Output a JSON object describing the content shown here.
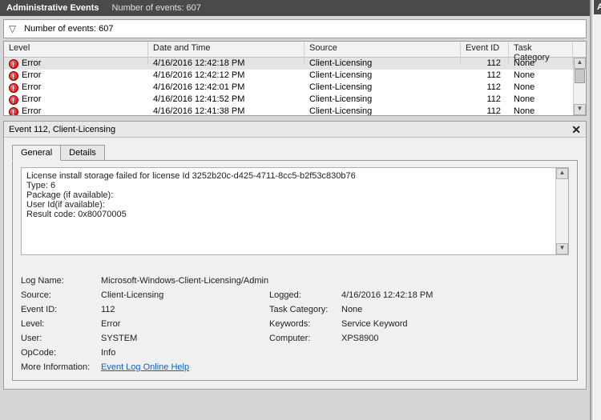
{
  "header": {
    "title": "Administrative Events",
    "subtitle": "Number of events: 607"
  },
  "filter": {
    "text": "Number of events: 607"
  },
  "columns": {
    "level": "Level",
    "datetime": "Date and Time",
    "source": "Source",
    "eventid": "Event ID",
    "taskcat": "Task Category"
  },
  "rows": [
    {
      "level": "Error",
      "datetime": "4/16/2016 12:42:18 PM",
      "source": "Client-Licensing",
      "eventid": "112",
      "taskcat": "None"
    },
    {
      "level": "Error",
      "datetime": "4/16/2016 12:42:12 PM",
      "source": "Client-Licensing",
      "eventid": "112",
      "taskcat": "None"
    },
    {
      "level": "Error",
      "datetime": "4/16/2016 12:42:01 PM",
      "source": "Client-Licensing",
      "eventid": "112",
      "taskcat": "None"
    },
    {
      "level": "Error",
      "datetime": "4/16/2016 12:41:52 PM",
      "source": "Client-Licensing",
      "eventid": "112",
      "taskcat": "None"
    },
    {
      "level": "Error",
      "datetime": "4/16/2016 12:41:38 PM",
      "source": "Client-Licensing",
      "eventid": "112",
      "taskcat": "None"
    }
  ],
  "detail": {
    "title": "Event 112, Client-Licensing",
    "tabs": {
      "general": "General",
      "details": "Details"
    },
    "message": {
      "line1": "License install storage failed for license Id 3252b20c-d425-4711-8cc5-b2f53c830b76",
      "line2": "Type: 6",
      "line3": "Package (if available):",
      "line4": "User Id(if available):",
      "line5": "Result code: 0x80070005"
    },
    "labels": {
      "logname": "Log Name:",
      "source": "Source:",
      "logged": "Logged:",
      "eventid": "Event ID:",
      "taskcat": "Task Category:",
      "level": "Level:",
      "keywords": "Keywords:",
      "user": "User:",
      "computer": "Computer:",
      "opcode": "OpCode:",
      "moreinfo": "More Information:"
    },
    "values": {
      "logname": "Microsoft-Windows-Client-Licensing/Admin",
      "source": "Client-Licensing",
      "logged": "4/16/2016 12:42:18 PM",
      "eventid": "112",
      "taskcat": "None",
      "level": "Error",
      "keywords": "Service Keyword",
      "user": "SYSTEM",
      "computer": "XPS8900",
      "opcode": "Info",
      "helplink": "Event Log Online Help"
    }
  },
  "side": {
    "head": "A"
  }
}
